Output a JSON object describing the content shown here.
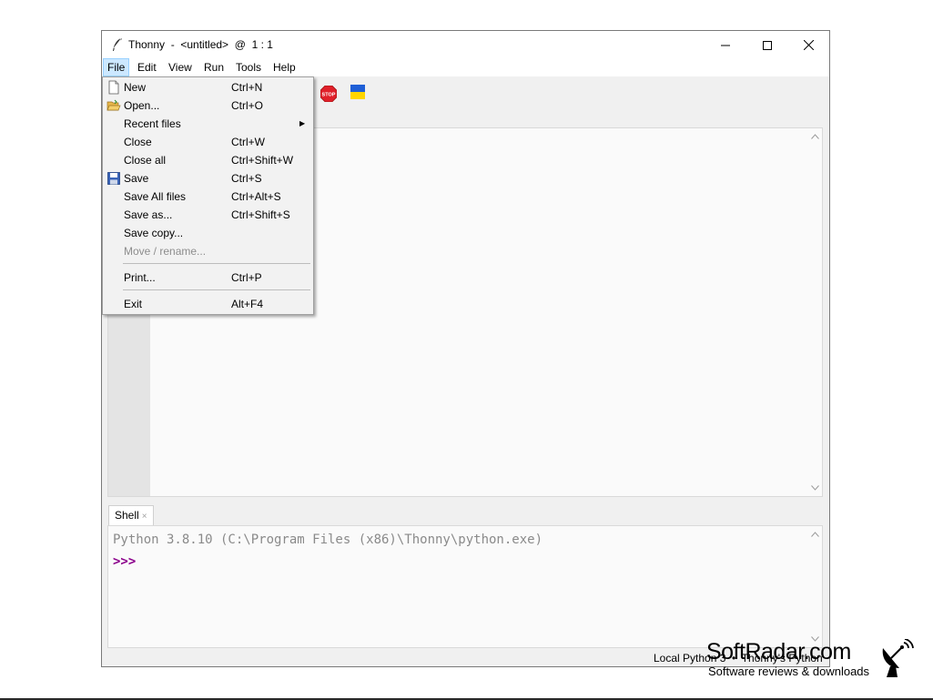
{
  "window": {
    "title": "Thonny  -  <untitled>  @  1 : 1",
    "minimize_glyph": "─",
    "maximize_glyph": "☐",
    "close_glyph": "✕"
  },
  "menubar": {
    "items": [
      {
        "label": "File",
        "active": true
      },
      {
        "label": "Edit"
      },
      {
        "label": "View"
      },
      {
        "label": "Run"
      },
      {
        "label": "Tools"
      },
      {
        "label": "Help"
      }
    ]
  },
  "toolbar": {
    "stop_label": "STOP",
    "icons": [
      "stop-icon",
      "ukraine-flag-icon"
    ]
  },
  "file_menu": {
    "items": [
      {
        "label": "New",
        "shortcut": "Ctrl+N",
        "icon": "new-file-icon"
      },
      {
        "label": "Open...",
        "shortcut": "Ctrl+O",
        "icon": "open-folder-icon"
      },
      {
        "label": "Recent files",
        "shortcut": "",
        "submenu": true
      },
      {
        "label": "Close",
        "shortcut": "Ctrl+W"
      },
      {
        "label": "Close all",
        "shortcut": "Ctrl+Shift+W"
      },
      {
        "label": "Save",
        "shortcut": "Ctrl+S",
        "icon": "save-icon"
      },
      {
        "label": "Save All files",
        "shortcut": "Ctrl+Alt+S"
      },
      {
        "label": "Save as...",
        "shortcut": "Ctrl+Shift+S"
      },
      {
        "label": "Save copy...",
        "shortcut": ""
      },
      {
        "label": "Move / rename...",
        "shortcut": "",
        "disabled": true
      },
      {
        "label": "Print...",
        "shortcut": "Ctrl+P"
      },
      {
        "label": "Exit",
        "shortcut": "Alt+F4"
      }
    ],
    "submenu_arrow": "▶"
  },
  "shell": {
    "tab_label": "Shell",
    "tab_close": "×",
    "banner": "Python 3.8.10 (C:\\Program Files (x86)\\Thonny\\python.exe)",
    "prompt": ">>>"
  },
  "statusbar": {
    "text": "Local Python 3  •  Thonny's Python"
  },
  "watermark": {
    "title": "SoftRadar.com",
    "subtitle": "Software reviews & downloads"
  },
  "colors": {
    "menu_active_bg": "#cce8ff",
    "prompt": "#8b008b",
    "banner_text": "#8a8a8a",
    "stop_red": "#e0202a",
    "flag_blue": "#1f5fd6",
    "flag_yellow": "#ffd500"
  }
}
